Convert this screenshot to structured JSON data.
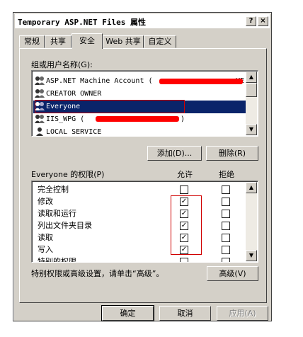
{
  "window": {
    "title": "Temporary ASP.NET Files 属性",
    "help_button": "?",
    "close_button": "×"
  },
  "tabs": [
    {
      "label": "常规",
      "active": false
    },
    {
      "label": "共享",
      "active": false
    },
    {
      "label": "安全",
      "active": true
    },
    {
      "label": "Web 共享",
      "active": false
    },
    {
      "label": "自定义",
      "active": false
    }
  ],
  "users_group": {
    "label": "组或用户名称(G):",
    "items": [
      {
        "name": "ASP.NET Machine Account (",
        "suffix": "VE"
      },
      {
        "name": "CREATOR OWNER",
        "suffix": ""
      },
      {
        "name": "Everyone",
        "suffix": ""
      },
      {
        "name": "IIS_WPG (",
        "suffix": ")"
      },
      {
        "name": "LOCAL SERVICE",
        "suffix": ""
      }
    ],
    "selected_index": 2
  },
  "buttons": {
    "add": "添加(D)...",
    "remove": "删除(R)",
    "advanced": "高级(V)",
    "ok": "确定",
    "cancel": "取消",
    "apply": "应用(A)"
  },
  "permissions": {
    "label": "Everyone 的权限(P)",
    "allow_header": "允许",
    "deny_header": "拒绝",
    "rows": [
      {
        "name": "完全控制",
        "allow": false,
        "deny": false
      },
      {
        "name": "修改",
        "allow": true,
        "deny": false
      },
      {
        "name": "读取和运行",
        "allow": true,
        "deny": false
      },
      {
        "name": "列出文件夹目录",
        "allow": true,
        "deny": false
      },
      {
        "name": "读取",
        "allow": true,
        "deny": false
      },
      {
        "name": "写入",
        "allow": true,
        "deny": false
      },
      {
        "name": "特别的权限",
        "allow": false,
        "deny": false
      }
    ]
  },
  "advanced_note": "特别权限或高级设置，请单击“高级”。",
  "colors": {
    "dialog_bg": "#d4d0c8",
    "selection": "#0a246a",
    "redaction": "#ff0000",
    "annotation_box": "#d00000"
  }
}
